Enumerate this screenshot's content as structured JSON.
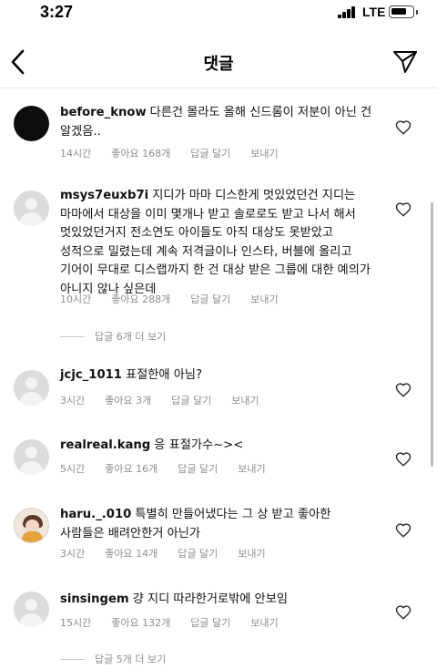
{
  "status_bar": {
    "time": "3:27",
    "network": "LTE"
  },
  "header": {
    "title": "댓글",
    "back_icon": "chevron-left-icon",
    "send_icon": "paper-plane-icon"
  },
  "comments": [
    {
      "username": "before_know",
      "text": "다른건 몰라도 올해 신드롬이 저분이 아닌 건 알겠음..",
      "time": "14시간",
      "likes": "좋아요 168개",
      "reply": "답글 달기",
      "send": "보내기",
      "avatar": "black"
    },
    {
      "username": "msys7euxb7i",
      "text": "지디가 마마 디스한게 멋있었던건 지디는 마마에서 대상을 이미 몇개나 받고 솔로로도 받고 나서 해서 멋있었던거지 전소연도 아이들도 아직 대상도 못받았고 성적으로 밀렸는데 계속 저격글이나 인스타, 버블에 올리고 기어이 무대로 디스랩까지 한 건 대상 받은 그룹에 대한 예의가 아니지 않나 싶은데",
      "time": "10시간",
      "likes": "좋아요 288개",
      "reply": "답글 달기",
      "send": "보내기",
      "avatar": "default",
      "view_replies": "답글 6개 더 보기"
    },
    {
      "username": "jcjc_1011",
      "text": "표절한애 아님?",
      "time": "3시간",
      "likes": "좋아요 3개",
      "reply": "답글 달기",
      "send": "보내기",
      "avatar": "default"
    },
    {
      "username": "realreal.kang",
      "text": "응 표절가수~><",
      "time": "5시간",
      "likes": "좋아요 16개",
      "reply": "답글 달기",
      "send": "보내기",
      "avatar": "default"
    },
    {
      "username": "haru._.010",
      "text": "특별히 만들어냈다는 그 상 받고 좋아한 사람들은 배려안한거 아닌가",
      "time": "3시간",
      "likes": "좋아요 14개",
      "reply": "답글 달기",
      "send": "보내기",
      "avatar": "photo"
    },
    {
      "username": "sinsingem",
      "text": "걍 지디 따라한거로밖에 안보임",
      "time": "15시간",
      "likes": "좋아요 132개",
      "reply": "답글 달기",
      "send": "보내기",
      "avatar": "default",
      "view_replies": "답글 5개 더 보기"
    }
  ],
  "colors": {
    "text": "#111111",
    "secondary_text": "#8e8e8e",
    "divider": "#ececec",
    "avatar_placeholder": "#dcdcdc"
  }
}
